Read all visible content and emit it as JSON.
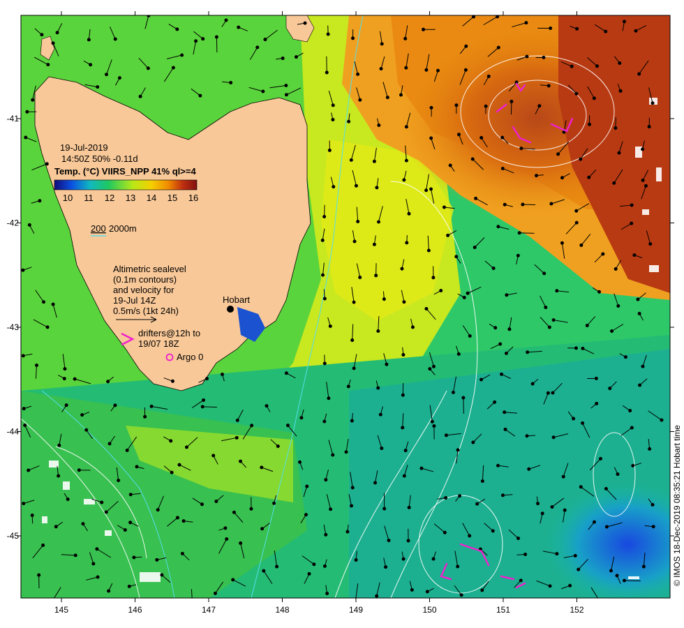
{
  "map": {
    "date": "19-Jul-2019",
    "time_line": "14:50Z  50% -0.11d",
    "colorbar_title": "Temp. (°C) VIIRS_NPP 41% ql>=4",
    "colorbar_ticks": [
      "10",
      "11",
      "12",
      "13",
      "14",
      "15",
      "16"
    ],
    "depth_contours": {
      "shallow": "200",
      "deep": "2000m"
    },
    "altimetry_note": [
      "Altimetric sealevel",
      "(0.1m contours)",
      "and velocity for",
      "19-Jul 14Z",
      "0.5m/s (1kt 24h)"
    ],
    "drifters_note": [
      "drifters@12h to",
      "19/07 18Z"
    ],
    "argo_note": "Argo 0",
    "city": "Hobart",
    "credit": "© IMOS 18-Dec-2019 08:35:21 Hobart time",
    "lon_ticks": [
      "145",
      "146",
      "147",
      "148",
      "149",
      "150",
      "151",
      "152"
    ],
    "lat_ticks": [
      "-41",
      "-42",
      "-43",
      "-44",
      "-45"
    ],
    "colors": {
      "land": "#f8c898",
      "contour_isobath": "#55ddee",
      "contour_sealevel": "#ffffff",
      "drifter": "#ee22cc",
      "colorbar_stops": [
        "#120a78",
        "#0a50e0",
        "#10b8c0",
        "#20c860",
        "#b8e818",
        "#f4d000",
        "#f08a00",
        "#c03010",
        "#801010"
      ]
    }
  }
}
